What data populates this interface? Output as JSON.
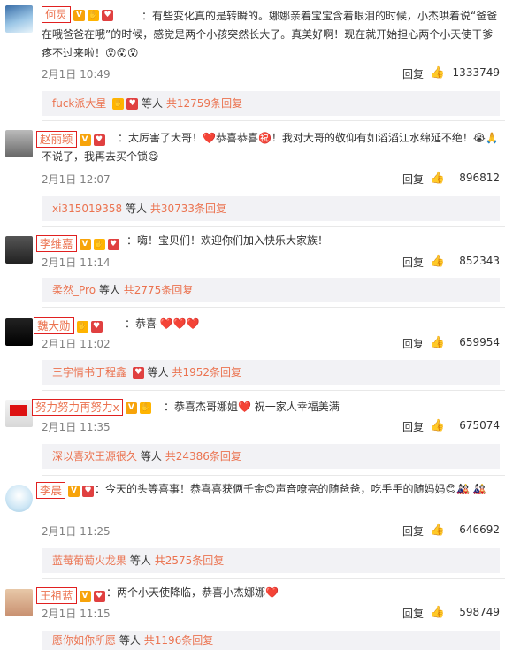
{
  "comments": [
    {
      "name": "何炅",
      "text": "：有些变化真的是转瞬的。娜娜亲着宝宝含着眼泪的时候，小杰哄着说“爸爸在哦爸爸在哦”的时候，感觉是两个小孩突然长大了。真美好啊！现在就开始担心两个小天使干爹疼不过来啦！😮😮😮",
      "time": "2月1日 10:49",
      "reply": "回复",
      "likes": "1333749",
      "sub_user": "fuck派大星",
      "sub_mid": "等人",
      "sub_count": "共12759条回复"
    },
    {
      "name": "赵丽颖",
      "text": "：太厉害了大哥！❤️恭喜恭喜㊗️！我对大哥的敬仰有如滔滔江水绵延不绝！😭🙏 不说了，我再去买个锁😋",
      "time": "2月1日 12:07",
      "reply": "回复",
      "likes": "896812",
      "sub_user": "xi315019358",
      "sub_mid": "等人",
      "sub_count": "共30733条回复"
    },
    {
      "name": "李维嘉",
      "text": "：嗨！宝贝们！欢迎你们加入快乐大家族！",
      "time": "2月1日 11:14",
      "reply": "回复",
      "likes": "852343",
      "sub_user": "柔然_Pro",
      "sub_mid": "等人",
      "sub_count": "共2775条回复"
    },
    {
      "name": "魏大勋",
      "text": "：恭喜 ❤️❤️❤️",
      "time": "2月1日 11:02",
      "reply": "回复",
      "likes": "659954",
      "sub_user": "三字情书丁程鑫",
      "sub_mid": "等人",
      "sub_count": "共1952条回复"
    },
    {
      "name": "努力努力再努力x",
      "text": "：恭喜杰哥娜姐❤️ 祝一家人幸福美满",
      "time": "2月1日 11:35",
      "reply": "回复",
      "likes": "675074",
      "sub_user": "深以喜欢王源很久",
      "sub_mid": "等人",
      "sub_count": "共24386条回复"
    },
    {
      "name": "李晨",
      "text": "：今天的头等喜事！恭喜喜获俩千金😊声音嘹亮的随爸爸，吃手手的随妈妈😊🎎 🎎",
      "time": "2月1日 11:25",
      "reply": "回复",
      "likes": "646692",
      "sub_user": "蓝莓葡萄火龙果",
      "sub_mid": "等人",
      "sub_count": "共2575条回复"
    },
    {
      "name": "王祖蓝",
      "text": "：两个小天使降临，恭喜小杰娜娜❤️",
      "time": "2月1日 11:15",
      "reply": "回复",
      "likes": "598749",
      "sub_user": "愿你如你所愿",
      "sub_mid": "等人",
      "sub_count": "共1196条回复"
    }
  ]
}
